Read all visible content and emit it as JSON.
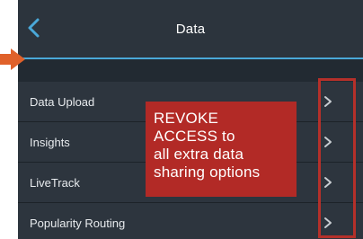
{
  "header": {
    "title": "Data",
    "back_icon": "chevron-left-icon"
  },
  "list": {
    "items": [
      {
        "label": "Data Upload",
        "icon": "chevron-right-icon"
      },
      {
        "label": "Insights",
        "icon": "chevron-right-icon"
      },
      {
        "label": "LiveTrack",
        "icon": "chevron-right-icon"
      },
      {
        "label": "Popularity Routing",
        "icon": "chevron-right-icon"
      }
    ]
  },
  "annotation": {
    "text": "REVOKE\nACCESS to\nall extra data\nsharing options",
    "color": "#b22a26",
    "arrow_icon": "arrow-right-icon"
  },
  "colors": {
    "navbar": "#2c343d",
    "background": "#222a32",
    "row": "#2d353e",
    "accent": "#4aa8d8",
    "highlight": "#b5302a"
  }
}
